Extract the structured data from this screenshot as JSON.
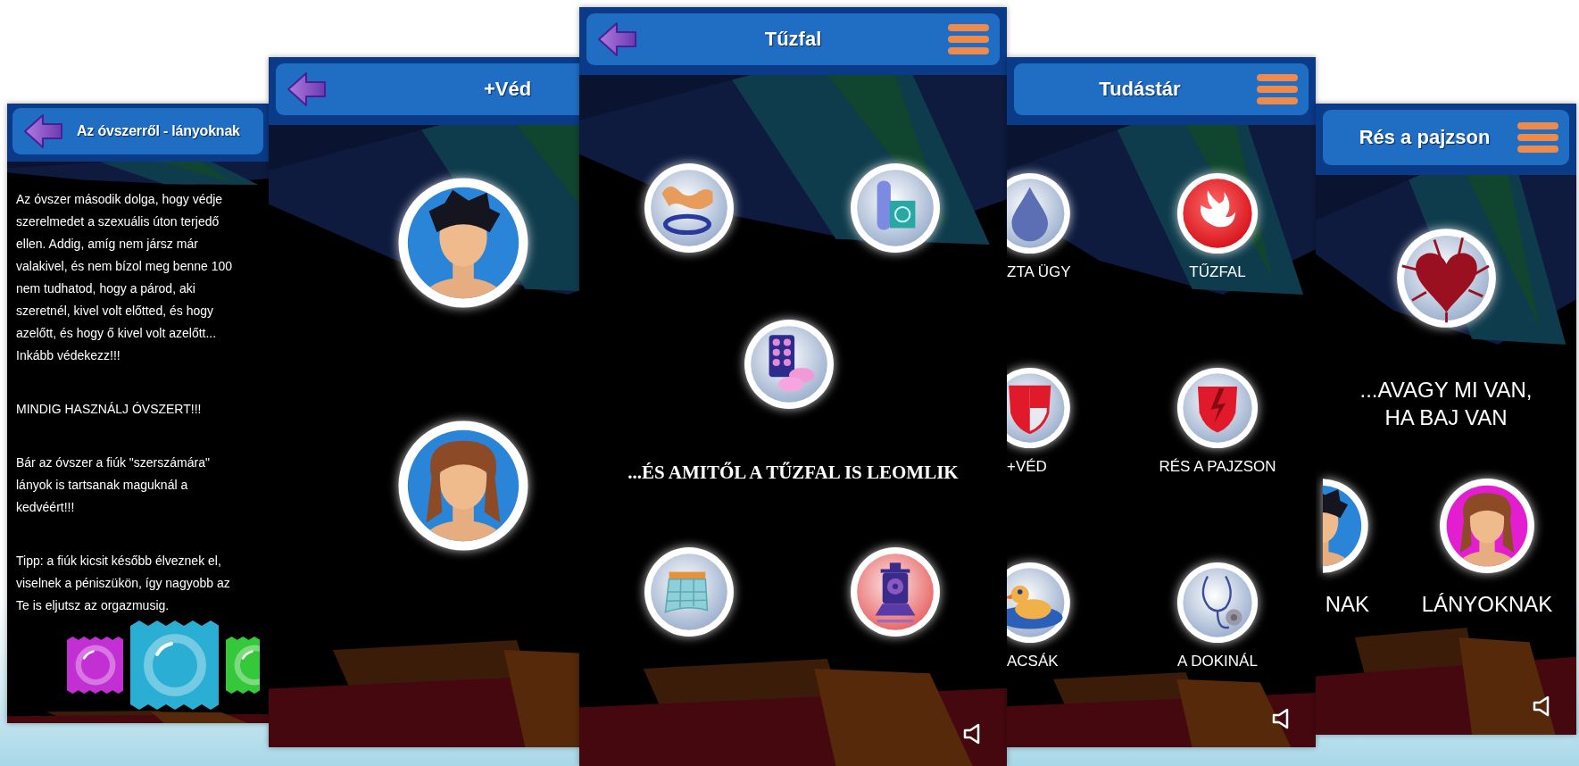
{
  "screens": [
    {
      "kind": "article",
      "title": "Az óvszerről - lányoknak",
      "back_button": true,
      "paragraphs": [
        [
          "Az óvszer második dolga, hogy védje",
          "szerelmedet a szexuális úton terjedő",
          "ellen. Addig, amíg nem jársz már",
          "valakivel, és nem bízol meg benne 100",
          "nem tudhatod, hogy a párod, aki",
          "szeretnél, kivel volt előtted, és hogy",
          "azelőtt, és hogy ő kivel volt azelőtt...",
          "Inkább védekezz!!!"
        ],
        [
          "MINDIG HASZNÁLJ ÓVSZERT!!!"
        ],
        [
          "Bár az óvszer a fiúk \"szerszámára\"",
          "lányok is tartsanak maguknál a",
          "kedvéért!!!"
        ],
        [
          "Tipp: a fiúk kicsit később élveznek el,",
          "viselnek a péniszükön, így nagyobb az",
          "Te is eljutsz az orgazmusig."
        ]
      ],
      "wrappers": [
        {
          "color": "#c22fd2"
        },
        {
          "color": "#2aaed4"
        },
        {
          "color": "#35c83a"
        }
      ]
    },
    {
      "kind": "avatars",
      "title": "+Véd",
      "back_button": true,
      "avatars": [
        {
          "kind": "boy",
          "color": "#2a84d8"
        },
        {
          "kind": "girl",
          "color": "#2a84d8"
        }
      ]
    },
    {
      "kind": "icons",
      "title": "Tűzfal",
      "back_button": true,
      "menu_button": true,
      "sound_button": true,
      "icons": [
        {
          "kind": "ring"
        },
        {
          "kind": "condom"
        },
        {
          "kind": "pills"
        },
        {
          "kind": "calendar"
        },
        {
          "kind": "train"
        }
      ],
      "caption": "...ÉS AMITŐL A TŰZFAL IS LEOMLIK"
    },
    {
      "kind": "menu",
      "title": "Tudástár",
      "menu_button": true,
      "sound_button": true,
      "items": [
        {
          "label": "ZTA ÜGY",
          "kind": "drop"
        },
        {
          "label": "TŰZFAL",
          "kind": "flame"
        },
        {
          "label": "+VÉD",
          "kind": "shield"
        },
        {
          "label": "RÉS A PAJZSON",
          "kind": "bolt"
        },
        {
          "label": "ACSÁK",
          "kind": "duck"
        },
        {
          "label": "A DOKINÁL",
          "kind": "stethoscope"
        }
      ]
    },
    {
      "kind": "topic",
      "title": "Rés a pajzson",
      "menu_button": true,
      "sound_button": true,
      "icon": {
        "kind": "heart"
      },
      "caption": "...AVAGY MI VAN, HA BAJ VAN",
      "avatars": [
        {
          "kind": "boy",
          "color": "#2a84d8",
          "label": "NAK"
        },
        {
          "kind": "girl",
          "color": "#e21ed0",
          "label": "LÁNYOKNAK"
        }
      ]
    }
  ]
}
